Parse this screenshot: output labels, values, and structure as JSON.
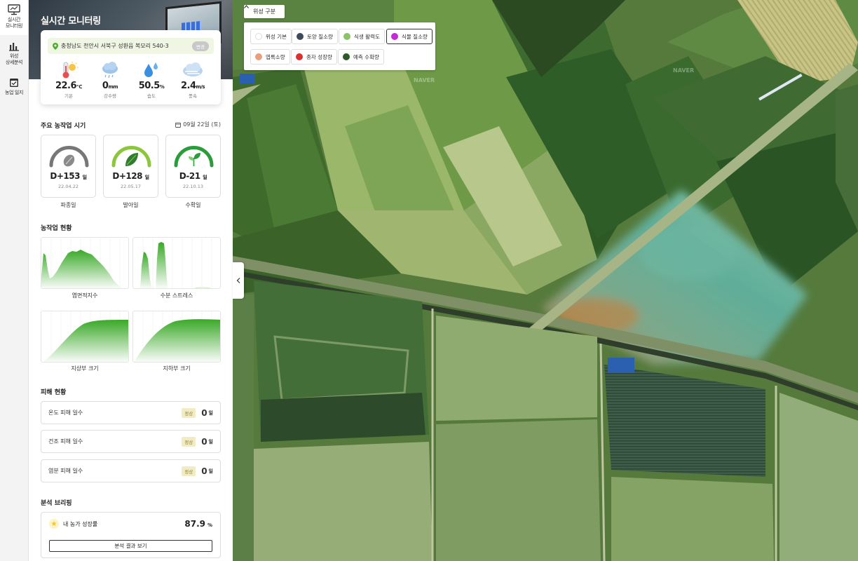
{
  "nav": {
    "items": [
      {
        "label": "실시간\n모니터링",
        "icon": "monitor-icon",
        "active": true
      },
      {
        "label": "위성\n상세분석",
        "icon": "bar-chart-icon",
        "active": false
      },
      {
        "label": "농업 일지",
        "icon": "calendar-check-icon",
        "active": false
      }
    ]
  },
  "panel": {
    "title": "실시간 모니터링",
    "address": "충청남도 천안시 서북구 성환읍 복모리 540-3",
    "change_label": "변경",
    "weather": [
      {
        "value": "22.6",
        "unit": "℃",
        "label": "기온",
        "icon": "thermometer-sun-icon"
      },
      {
        "value": "0",
        "unit": "mm",
        "label": "강수량",
        "icon": "rain-cloud-icon"
      },
      {
        "value": "50.5",
        "unit": "%",
        "label": "습도",
        "icon": "water-drops-icon"
      },
      {
        "value": "2.4",
        "unit": "m/s",
        "label": "풍속",
        "icon": "wind-cloud-icon"
      }
    ]
  },
  "schedule": {
    "title": "주요 농작업 시기",
    "date": "09월 22일 (토)",
    "cards": [
      {
        "dday": "D+153",
        "unit": "일",
        "date": "22.04.22",
        "label": "파종일",
        "icon": "seed-icon",
        "color": "#777777"
      },
      {
        "dday": "D+128",
        "unit": "일",
        "date": "22.05.17",
        "label": "발아일",
        "icon": "leaf-icon",
        "color": "#8cc63f"
      },
      {
        "dday": "D-21",
        "unit": "일",
        "date": "22.10.13",
        "label": "수확일",
        "icon": "sprout-icon",
        "color": "#2a9d3a"
      }
    ]
  },
  "status": {
    "title": "농작업 현황",
    "charts": [
      {
        "label": "엽면적지수"
      },
      {
        "label": "수분 스트레스"
      },
      {
        "label": "지상부 크기"
      },
      {
        "label": "지하부 크기"
      }
    ]
  },
  "damage": {
    "title": "피해 현황",
    "rows": [
      {
        "label": "온도 피해 일수",
        "badge": "정상",
        "value": "0",
        "unit": "일"
      },
      {
        "label": "건조 피해 일수",
        "badge": "정상",
        "value": "0",
        "unit": "일"
      },
      {
        "label": "염분 피해 일수",
        "badge": "정상",
        "value": "0",
        "unit": "일"
      }
    ]
  },
  "briefing": {
    "title": "분석 브리핑",
    "item_label": "내 농가 성장률",
    "value": "87.9",
    "unit": "%",
    "button": "분석 결과 보기"
  },
  "satellite": {
    "toggle_label": "위성 구분",
    "options": [
      {
        "label": "위성 기본",
        "color": "#ffffff",
        "selected": false
      },
      {
        "label": "토양 질소량",
        "color": "#3d4a5c",
        "selected": false
      },
      {
        "label": "식생 활력도",
        "color": "#8cc36a",
        "selected": false
      },
      {
        "label": "식물 질소량",
        "color": "#c42bd6",
        "selected": true
      },
      {
        "label": "엽록소량",
        "color": "#e8a07a",
        "selected": false
      },
      {
        "label": "종자 성장량",
        "color": "#d93030",
        "selected": false
      },
      {
        "label": "예측 수확량",
        "color": "#2d5a2a",
        "selected": false
      }
    ]
  },
  "map": {
    "watermark": "NAVER"
  }
}
